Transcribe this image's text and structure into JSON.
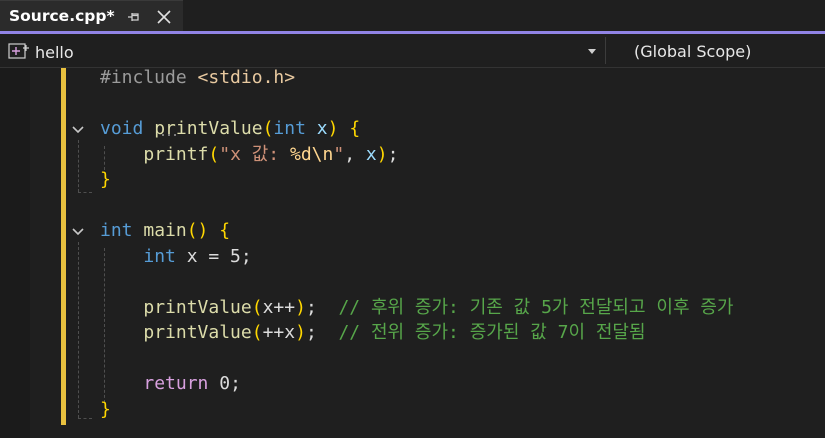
{
  "tab": {
    "title": "Source.cpp*",
    "pin_icon": "pin-icon",
    "close_icon": "close-icon"
  },
  "navbar": {
    "project": "hello",
    "scope": "(Global Scope)",
    "project_icon": "project-icon"
  },
  "colors": {
    "accent": "#9184e6",
    "change_bar": "#e9c13f",
    "keyword": "#569cd6",
    "function": "#dcdcaa",
    "comment": "#57a64a",
    "string": "#ce9178",
    "brace": "#ffd700",
    "control": "#d8a0df"
  },
  "code": {
    "lines": [
      {
        "tokens": [
          {
            "t": "#include ",
            "k": "pre"
          },
          {
            "t": "<stdio.h>",
            "k": "str"
          }
        ]
      },
      {
        "tokens": []
      },
      {
        "tokens": [
          {
            "t": "void",
            "k": "kw"
          },
          {
            "t": " ",
            "k": "pu"
          },
          {
            "t": "printValue",
            "k": "fn"
          },
          {
            "t": "(",
            "k": "br"
          },
          {
            "t": "int",
            "k": "kw"
          },
          {
            "t": " ",
            "k": "pu"
          },
          {
            "t": "x",
            "k": "pa"
          },
          {
            "t": ")",
            "k": "br"
          },
          {
            "t": " ",
            "k": "pu"
          },
          {
            "t": "{",
            "k": "br"
          }
        ]
      },
      {
        "tokens": [
          {
            "t": "    ",
            "k": "pu"
          },
          {
            "t": "printf",
            "k": "fn"
          },
          {
            "t": "(",
            "k": "br"
          },
          {
            "t": "\"x 값: ",
            "k": "sr"
          },
          {
            "t": "%d\\n",
            "k": "fmt"
          },
          {
            "t": "\"",
            "k": "sr"
          },
          {
            "t": ", ",
            "k": "pu"
          },
          {
            "t": "x",
            "k": "pa"
          },
          {
            "t": ")",
            "k": "br"
          },
          {
            "t": ";",
            "k": "pu"
          }
        ]
      },
      {
        "tokens": [
          {
            "t": "}",
            "k": "br"
          }
        ]
      },
      {
        "tokens": []
      },
      {
        "tokens": [
          {
            "t": "int",
            "k": "kw"
          },
          {
            "t": " ",
            "k": "pu"
          },
          {
            "t": "main",
            "k": "fn"
          },
          {
            "t": "()",
            "k": "br"
          },
          {
            "t": " ",
            "k": "pu"
          },
          {
            "t": "{",
            "k": "br"
          }
        ]
      },
      {
        "tokens": [
          {
            "t": "    ",
            "k": "pu"
          },
          {
            "t": "int",
            "k": "kw"
          },
          {
            "t": " x = 5;",
            "k": "pu"
          }
        ]
      },
      {
        "tokens": []
      },
      {
        "tokens": [
          {
            "t": "    ",
            "k": "pu"
          },
          {
            "t": "printValue",
            "k": "fn"
          },
          {
            "t": "(",
            "k": "br"
          },
          {
            "t": "x++",
            "k": "pu"
          },
          {
            "t": ")",
            "k": "br"
          },
          {
            "t": ";  ",
            "k": "pu"
          },
          {
            "t": "// 후위 증가: 기존 값 5가 전달되고 이후 증가",
            "k": "cm"
          }
        ]
      },
      {
        "tokens": [
          {
            "t": "    ",
            "k": "pu"
          },
          {
            "t": "printValue",
            "k": "fn"
          },
          {
            "t": "(",
            "k": "br"
          },
          {
            "t": "++x",
            "k": "pu"
          },
          {
            "t": ")",
            "k": "br"
          },
          {
            "t": ";  ",
            "k": "pu"
          },
          {
            "t": "// 전위 증가: 증가된 값 7이 전달됨",
            "k": "cm"
          }
        ]
      },
      {
        "tokens": []
      },
      {
        "tokens": [
          {
            "t": "    ",
            "k": "pu"
          },
          {
            "t": "return",
            "k": "ctl"
          },
          {
            "t": " 0;",
            "k": "pu"
          }
        ]
      },
      {
        "tokens": [
          {
            "t": "}",
            "k": "br"
          }
        ]
      }
    ],
    "fold_icons": [
      "fold-chevron-icon",
      "fold-chevron-icon"
    ]
  }
}
